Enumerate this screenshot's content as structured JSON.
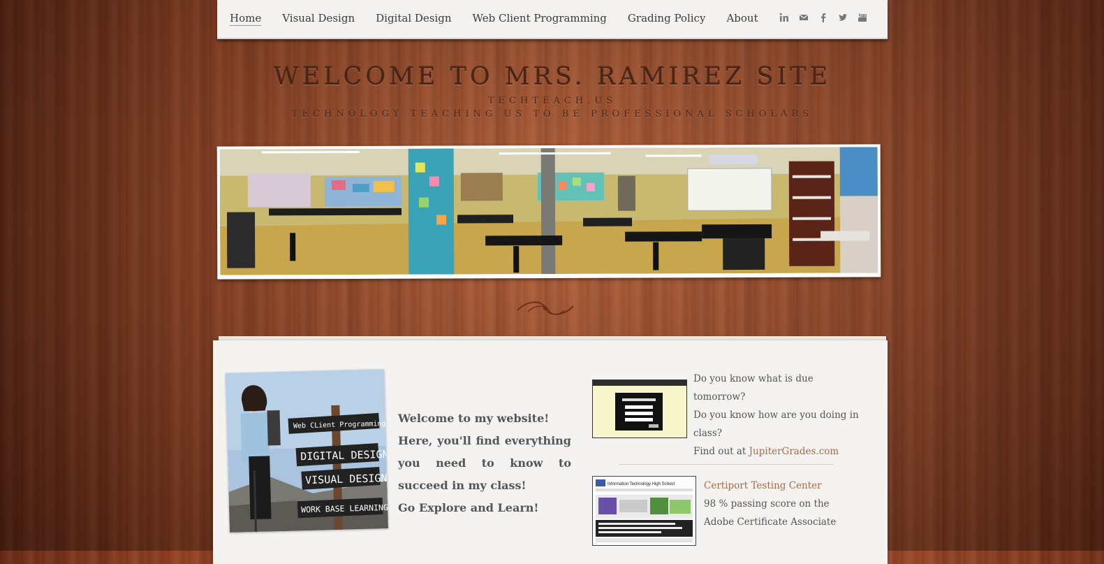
{
  "nav": {
    "items": [
      {
        "label": "Home"
      },
      {
        "label": "Visual Design"
      },
      {
        "label": "Digital Design"
      },
      {
        "label": "Web Client Programming"
      },
      {
        "label": "Grading Policy"
      },
      {
        "label": "About"
      }
    ],
    "social": [
      "linkedin-icon",
      "mail-icon",
      "facebook-icon",
      "twitter-icon",
      "youtube-icon"
    ]
  },
  "header": {
    "title": "WELCOME TO MRS. RAMIREZ SITE",
    "subtitle": "TECHTEACH.US",
    "tagline": "TECHNOLOGY TEACHING US TO BE PROFESSIONAL SCHOLARS"
  },
  "intro": {
    "line1": "Welcome to my website!",
    "line2": "Here, you'll find everything you need to know to succeed in my class!",
    "line3": "Go Explore and Learn!",
    "sign_lines": [
      "Web CLient Programming",
      "DIGITAL DESIGN",
      "VISUAL DESIGN",
      "WORK BASE LEARNING"
    ]
  },
  "jupiter": {
    "q1": "Do you know what is due tomorrow?",
    "q2": "Do you know how are you doing in class?",
    "find_prefix": "Find out at ",
    "link": "JupiterGrades.com"
  },
  "certiport": {
    "title": "Certiport Testing Center",
    "line1": "98 % passing score  on the",
    "line2": "Adobe Certificate Associate",
    "thumb_title": "Information Technology High School"
  },
  "colors": {
    "wood": "#a24d2b",
    "paper": "#f4f3f1",
    "link": "#a66a48",
    "title": "#4a2416"
  }
}
